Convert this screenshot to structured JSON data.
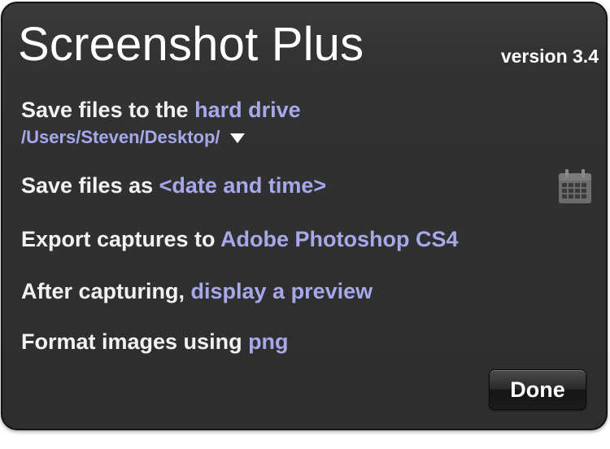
{
  "app": {
    "title": "Screenshot Plus",
    "version": "version 3.4"
  },
  "settings": {
    "save_location": {
      "label": "Save files to the ",
      "value": "hard drive",
      "path": "/Users/Steven/Desktop/"
    },
    "file_name": {
      "label": "Save files as ",
      "value": "<date and time>"
    },
    "export": {
      "label": "Export captures to ",
      "value": "Adobe Photoshop CS4"
    },
    "after_capture": {
      "label": "After capturing, ",
      "value": "display a preview"
    },
    "format": {
      "label": "Format images using ",
      "value": "png"
    }
  },
  "buttons": {
    "done_label": "Done"
  },
  "icons": {
    "calendar": "calendar-icon",
    "path_dropdown": "triangle-down-icon"
  },
  "colors": {
    "panel_background": "#303030",
    "text": "#ffffff",
    "link": "#a6a8ea"
  }
}
